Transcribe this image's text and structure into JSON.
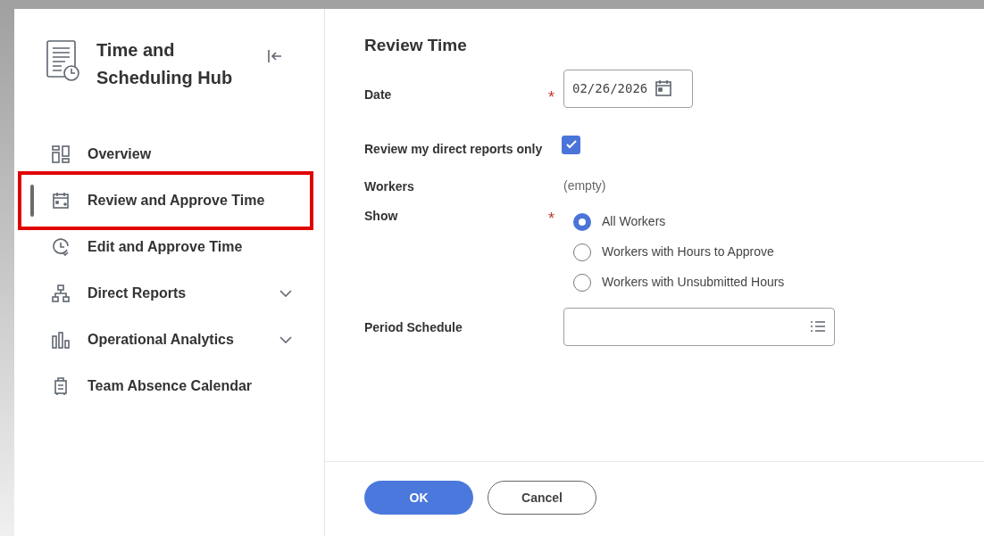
{
  "sidebar": {
    "title": "Time and Scheduling Hub",
    "items": [
      {
        "label": "Overview",
        "selected": false,
        "highlighted": false
      },
      {
        "label": "Review and Approve Time",
        "selected": true,
        "highlighted": true
      },
      {
        "label": "Edit and Approve Time",
        "selected": false,
        "highlighted": false
      },
      {
        "label": "Direct Reports",
        "selected": false,
        "highlighted": false,
        "expanded": false
      },
      {
        "label": "Operational Analytics",
        "selected": false,
        "highlighted": false,
        "expanded": false
      },
      {
        "label": "Team Absence Calendar",
        "selected": false,
        "highlighted": false
      }
    ]
  },
  "form": {
    "title": "Review Time",
    "fields": [
      {
        "kind": "date",
        "label": "Date",
        "required_mark": "*",
        "value": "02/26/2026"
      },
      {
        "kind": "checkbox",
        "label": "Review my direct reports only",
        "checked": true
      },
      {
        "kind": "text",
        "label": "Workers",
        "value": "(empty)"
      },
      {
        "kind": "radio",
        "label": "Show",
        "required_mark": "*",
        "options": [
          {
            "label": "All Workers",
            "selected": true
          },
          {
            "label": "Workers with Hours to Approve",
            "selected": false
          },
          {
            "label": "Workers with Unsubmitted Hours",
            "selected": false
          }
        ]
      },
      {
        "kind": "prompt",
        "label": "Period Schedule"
      }
    ]
  },
  "buttons": [
    {
      "label": "OK",
      "primary": true
    },
    {
      "label": "Cancel",
      "primary": false
    }
  ]
}
